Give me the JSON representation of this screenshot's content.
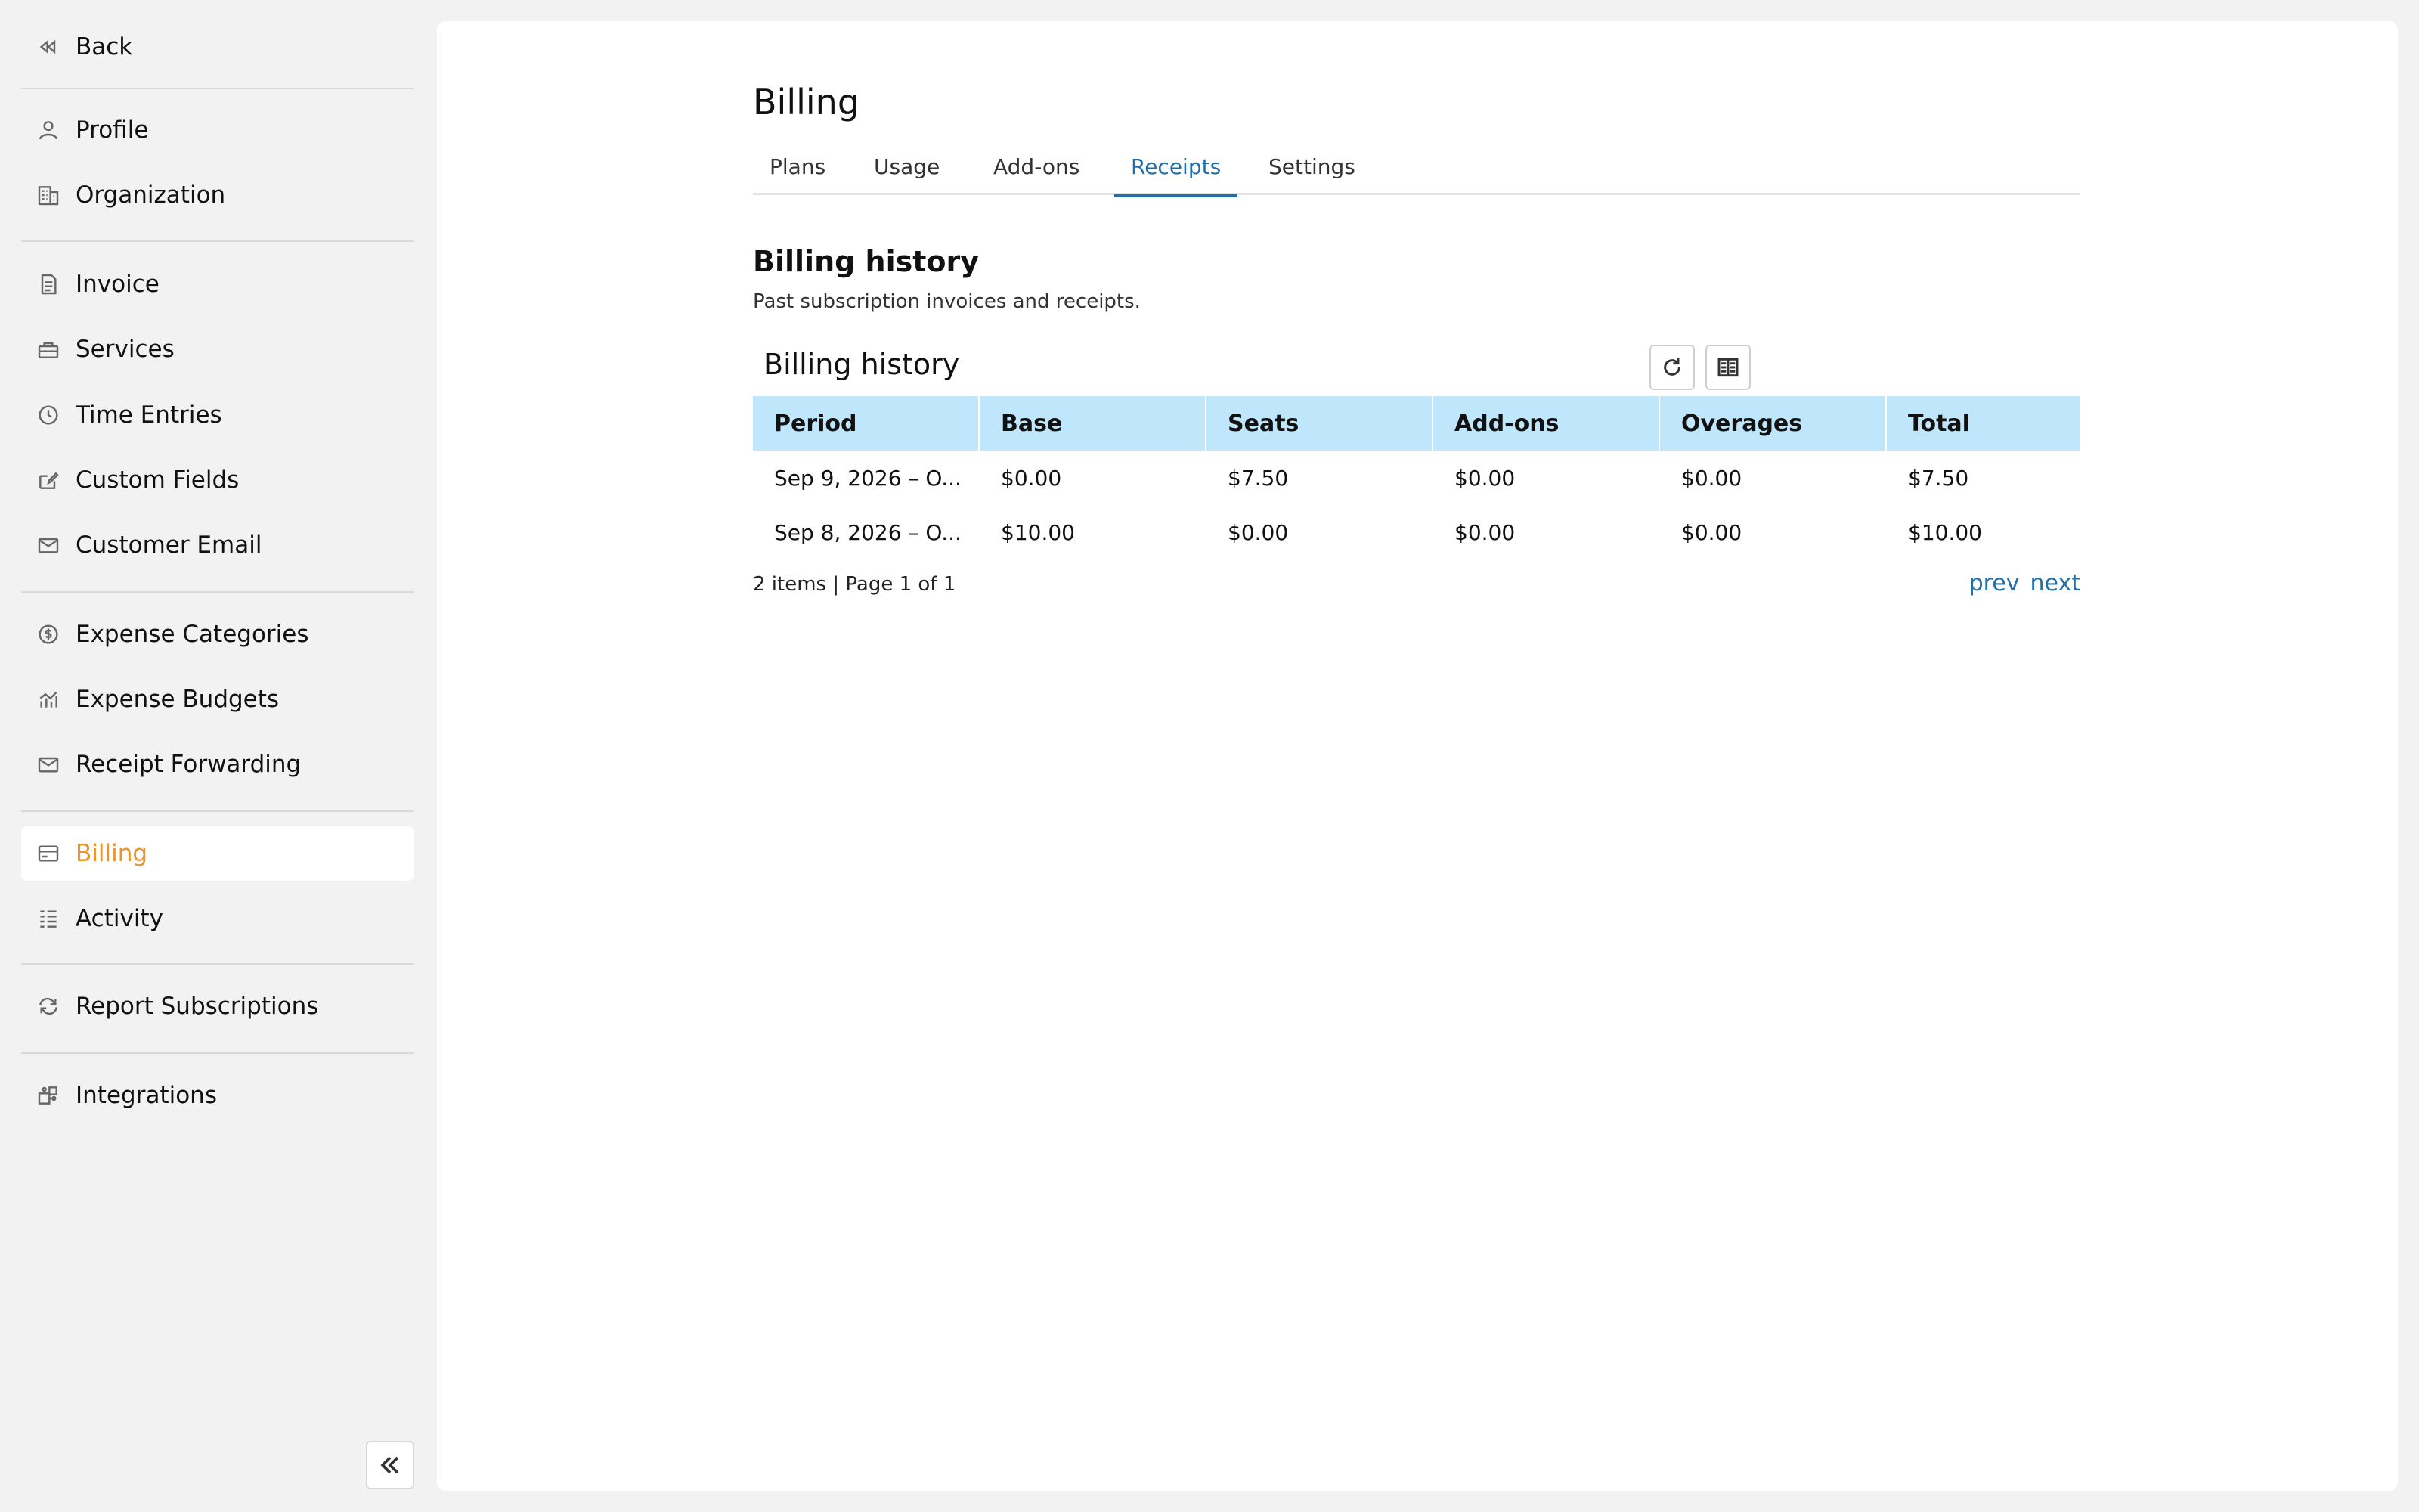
{
  "sidebar": {
    "back_label": "Back",
    "items": [
      {
        "label": "Profile",
        "icon": "user-icon"
      },
      {
        "label": "Organization",
        "icon": "building-icon"
      },
      {
        "label": "Invoice",
        "icon": "document-icon"
      },
      {
        "label": "Services",
        "icon": "toolbox-icon"
      },
      {
        "label": "Time Entries",
        "icon": "clock-icon"
      },
      {
        "label": "Custom Fields",
        "icon": "edit-icon"
      },
      {
        "label": "Customer Email",
        "icon": "mail-icon"
      },
      {
        "label": "Expense Categories",
        "icon": "dollar-circle-icon"
      },
      {
        "label": "Expense Budgets",
        "icon": "chart-icon"
      },
      {
        "label": "Receipt Forwarding",
        "icon": "mail-icon"
      },
      {
        "label": "Billing",
        "icon": "credit-card-icon",
        "active": true
      },
      {
        "label": "Activity",
        "icon": "list-icon"
      },
      {
        "label": "Report Subscriptions",
        "icon": "repeat-icon"
      },
      {
        "label": "Integrations",
        "icon": "puzzle-icon"
      }
    ]
  },
  "page": {
    "title": "Billing",
    "tabs": [
      {
        "label": "Plans"
      },
      {
        "label": "Usage"
      },
      {
        "label": "Add-ons"
      },
      {
        "label": "Receipts",
        "active": true
      },
      {
        "label": "Settings"
      }
    ],
    "section_title": "Billing history",
    "section_desc": "Past subscription invoices and receipts."
  },
  "table": {
    "title": "Billing history",
    "columns": [
      "Period",
      "Base",
      "Seats",
      "Add-ons",
      "Overages",
      "Total"
    ],
    "rows": [
      [
        "Sep 9, 2026 – O...",
        "$0.00",
        "$7.50",
        "$0.00",
        "$0.00",
        "$7.50"
      ],
      [
        "Sep 8, 2026 – O...",
        "$10.00",
        "$0.00",
        "$0.00",
        "$0.00",
        "$10.00"
      ]
    ],
    "pager_info": "2 items | Page 1 of 1",
    "prev_label": "prev",
    "next_label": "next"
  },
  "colors": {
    "accent": "#1f6fa8",
    "active_nav": "#e8952c",
    "table_header": "#bfe6fb"
  }
}
